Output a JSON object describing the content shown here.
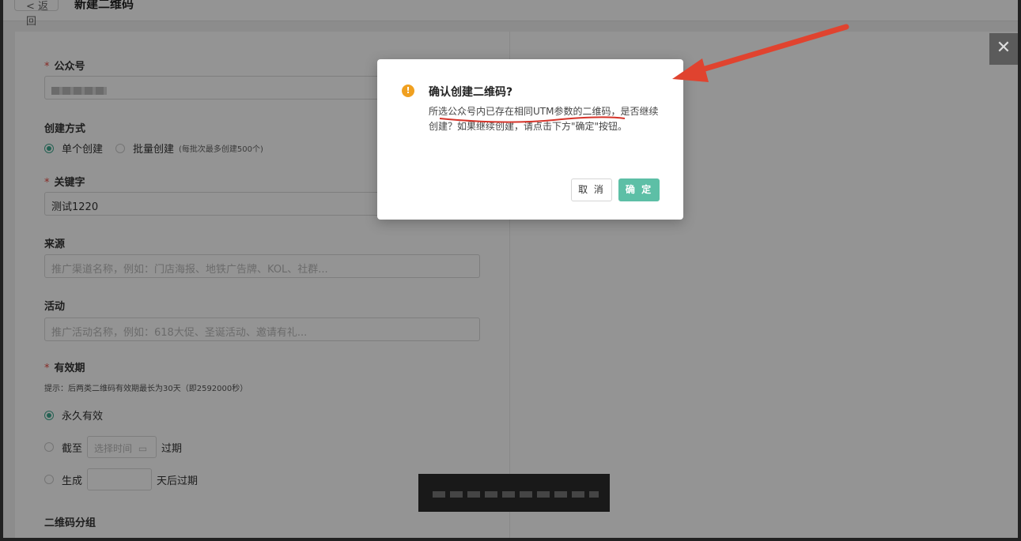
{
  "header": {
    "back_label": "< 返回",
    "title": "新建二维码"
  },
  "form": {
    "account": {
      "label": "公众号"
    },
    "method": {
      "label": "创建方式",
      "options": [
        "单个创建",
        "批量创建"
      ],
      "note": "(每批次最多创建500个)",
      "selected": "单个创建"
    },
    "keyword": {
      "label": "关键字",
      "value": "测试1220"
    },
    "source": {
      "label": "来源",
      "placeholder": "推广渠道名称，例如：门店海报、地铁广告牌、KOL、社群..."
    },
    "campaign": {
      "label": "活动",
      "placeholder": "推广活动名称，例如：618大促、圣诞活动、邀请有礼..."
    },
    "validity": {
      "label": "有效期",
      "hint": "提示：后两类二维码有效期最长为30天（即2592000秒）",
      "permanent": "永久有效",
      "until_prefix": "截至",
      "until_placeholder": "选择时间",
      "until_suffix": "过期",
      "gen_prefix": "生成",
      "gen_suffix": "天后过期"
    },
    "group": {
      "label": "二维码分组"
    }
  },
  "dialog": {
    "title": "确认创建二维码?",
    "message": "所选公众号内已存在相同UTM参数的二维码，是否继续创建？如果继续创建，请点击下方\"确定\"按钮。",
    "cancel": "取 消",
    "ok": "确 定"
  },
  "colors": {
    "accent": "#5dbfa6",
    "warning": "#f0a020",
    "required": "#e94b43",
    "annotation_arrow": "#e0432f"
  }
}
